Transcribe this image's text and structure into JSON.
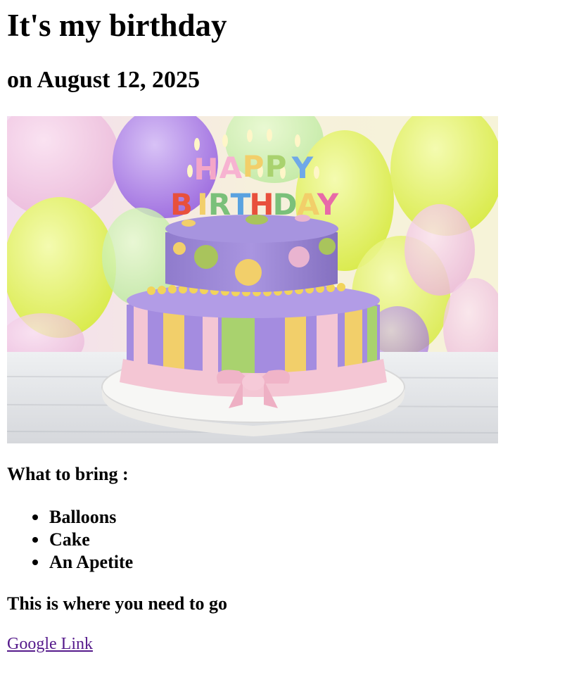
{
  "heading": {
    "title": "It's my birthday",
    "date": "on August 12, 2025"
  },
  "photo": {
    "subject": "birthday-cake-image",
    "cake_topper": [
      "HAPPY",
      "BIRTHDAY"
    ],
    "colors": {
      "balloon_yellow": "#e6f06a",
      "balloon_purple": "#b58de8",
      "balloon_pink": "#f2c3e2",
      "cake_purple": "#9b86d6",
      "ribbon_pink": "#f4c6d4",
      "stripe_yellow": "#f2cf6a",
      "stripe_green": "#a9d26e",
      "table_white": "#e9eaec"
    }
  },
  "bring": {
    "heading": "What to bring :",
    "items": [
      "Balloons",
      "Cake",
      "An Apetite"
    ]
  },
  "directions": {
    "heading": "This is where you need to go",
    "link_text": "Google Link",
    "link_color": "#551a8b"
  }
}
